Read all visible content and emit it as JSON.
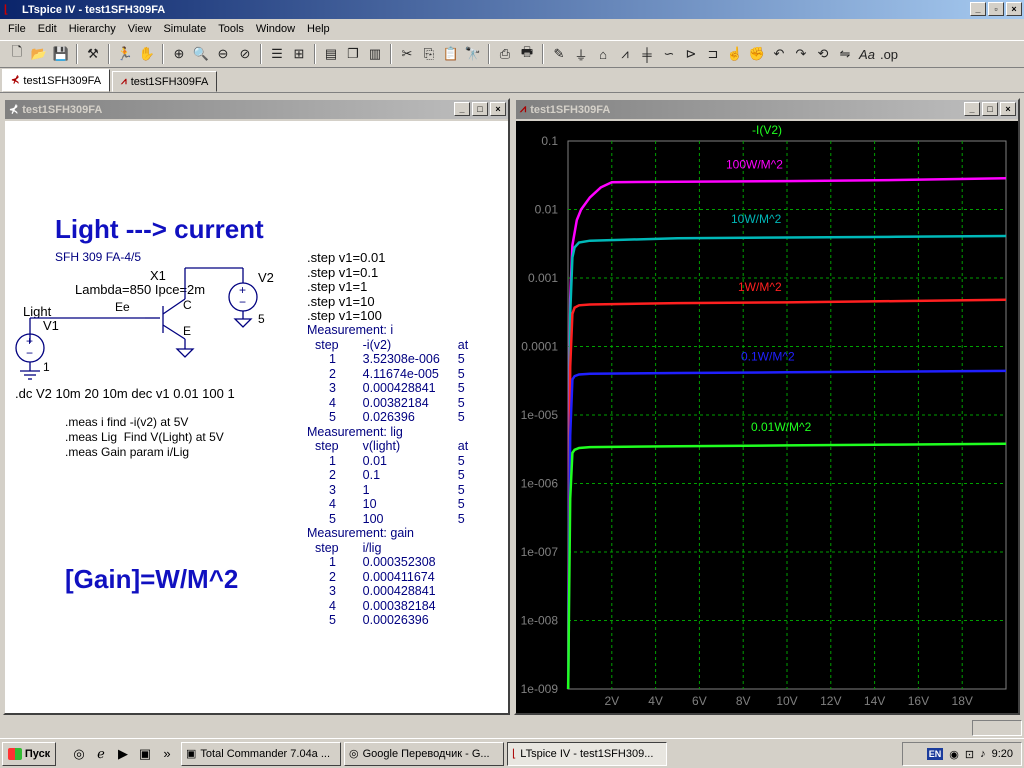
{
  "window": {
    "title": "LTspice IV - test1SFH309FA",
    "minimize": "_",
    "restore": "▫",
    "close": "×"
  },
  "menu": [
    {
      "label": "File",
      "mn": "F"
    },
    {
      "label": "Edit",
      "mn": "E"
    },
    {
      "label": "Hierarchy",
      "mn": "H"
    },
    {
      "label": "View",
      "mn": "V"
    },
    {
      "label": "Simulate",
      "mn": "S"
    },
    {
      "label": "Tools",
      "mn": "T"
    },
    {
      "label": "Window",
      "mn": "W"
    },
    {
      "label": "Help",
      "mn": "H"
    }
  ],
  "tabs": [
    {
      "label": "test1SFH309FA",
      "icon": "transistor-icon"
    },
    {
      "label": "test1SFH309FA",
      "icon": "waveform-icon"
    }
  ],
  "schematic": {
    "title": "test1SFH309FA",
    "heading": "Light ---> current",
    "part": "SFH 309 FA-4/5",
    "x1": "X1",
    "lambda": "Lambda=850 Ipce=2m",
    "c": "C",
    "e": "E",
    "ee": "Ee",
    "v2": "V2",
    "v2_val": "5",
    "light": "Light",
    "v1": "V1",
    "v1_val": "1",
    "dc": ".dc V2 10m 20 10m dec v1 0.01 100 1",
    "meas1": ".meas i find -i(v2) at 5V",
    "meas2": ".meas Lig  Find V(Light) at 5V",
    "meas3": ".meas Gain param i/Lig",
    "gain": "[Gain]=W/M^2",
    "steps": [
      ".step v1=0.01",
      ".step v1=0.1",
      ".step v1=1",
      ".step v1=10",
      ".step v1=100"
    ],
    "measurements": [
      {
        "title": "Measurement: i",
        "cols": [
          "step",
          "-i(v2)",
          "at"
        ],
        "rows": [
          [
            "1",
            "3.52308e-006",
            "5"
          ],
          [
            "2",
            "4.11674e-005",
            "5"
          ],
          [
            "3",
            "0.000428841",
            "5"
          ],
          [
            "4",
            "0.00382184",
            "5"
          ],
          [
            "5",
            "0.026396",
            "5"
          ]
        ]
      },
      {
        "title": "Measurement: lig",
        "cols": [
          "step",
          "v(light)",
          "at"
        ],
        "rows": [
          [
            "1",
            "0.01",
            "5"
          ],
          [
            "2",
            "0.1",
            "5"
          ],
          [
            "3",
            "1",
            "5"
          ],
          [
            "4",
            "10",
            "5"
          ],
          [
            "5",
            "100",
            "5"
          ]
        ]
      },
      {
        "title": "Measurement: gain",
        "cols": [
          "step",
          "i/lig",
          ""
        ],
        "rows": [
          [
            "1",
            "0.000352308",
            ""
          ],
          [
            "2",
            "0.000411674",
            ""
          ],
          [
            "3",
            "0.000428841",
            ""
          ],
          [
            "4",
            "0.000382184",
            ""
          ],
          [
            "5",
            "0.00026396",
            ""
          ]
        ]
      }
    ]
  },
  "waveform": {
    "title": "test1SFH309FA"
  },
  "chart_data": {
    "type": "line",
    "title": "-I(V2)",
    "xlabel": "",
    "ylabel": "",
    "xlim": [
      0,
      20
    ],
    "ylim": [
      1e-09,
      0.1
    ],
    "yscale": "log",
    "grid": true,
    "x_ticks": [
      "2V",
      "4V",
      "6V",
      "8V",
      "10V",
      "12V",
      "14V",
      "16V",
      "18V"
    ],
    "y_ticks": [
      "0.1",
      "0.01",
      "0.001",
      "0.0001",
      "1e-005",
      "1e-006",
      "1e-007",
      "1e-008",
      "1e-009"
    ],
    "series": [
      {
        "name": "100W/M^2",
        "color": "#ff00ff",
        "x": [
          0.01,
          0.05,
          0.1,
          0.2,
          0.4,
          0.6,
          1.0,
          1.5,
          2.0,
          5,
          10,
          15,
          20
        ],
        "y": [
          1e-09,
          1e-05,
          0.0005,
          0.003,
          0.007,
          0.01,
          0.015,
          0.021,
          0.025,
          0.0255,
          0.026,
          0.027,
          0.0285
        ]
      },
      {
        "name": "10W/M^2",
        "color": "#00b8b8",
        "x": [
          0.01,
          0.05,
          0.1,
          0.2,
          0.3,
          0.5,
          1,
          5,
          10,
          15,
          20
        ],
        "y": [
          1e-09,
          1e-06,
          0.0003,
          0.002,
          0.0028,
          0.0033,
          0.0035,
          0.0038,
          0.0039,
          0.004,
          0.0041
        ]
      },
      {
        "name": "1W/M^2",
        "color": "#ff2020",
        "x": [
          0.01,
          0.05,
          0.1,
          0.2,
          0.3,
          0.5,
          1,
          5,
          10,
          15,
          20
        ],
        "y": [
          1e-09,
          2e-07,
          5e-05,
          0.0003,
          0.00037,
          0.0004,
          0.00041,
          0.00043,
          0.00044,
          0.00046,
          0.00048
        ]
      },
      {
        "name": "0.1W/M^2",
        "color": "#2020ff",
        "x": [
          0.01,
          0.05,
          0.1,
          0.2,
          0.3,
          0.5,
          1,
          5,
          10,
          15,
          20
        ],
        "y": [
          1e-09,
          8e-08,
          5e-06,
          3.3e-05,
          3.7e-05,
          3.9e-05,
          4e-05,
          4.1e-05,
          4.2e-05,
          4.3e-05,
          4.4e-05
        ]
      },
      {
        "name": "0.01W/M^2",
        "color": "#20ff20",
        "x": [
          0.01,
          0.05,
          0.1,
          0.2,
          0.3,
          0.5,
          1,
          5,
          10,
          15,
          20
        ],
        "y": [
          1e-09,
          2e-08,
          6e-07,
          2.8e-06,
          3.1e-06,
          3.3e-06,
          3.4e-06,
          3.5e-06,
          3.6e-06,
          3.7e-06,
          3.8e-06
        ]
      }
    ]
  },
  "taskbar": {
    "start": "Пуск",
    "tasks": [
      {
        "label": "Total Commander 7.04a ...",
        "icon": "floppy-icon"
      },
      {
        "label": "Google Переводчик - G...",
        "icon": "chrome-icon"
      },
      {
        "label": "LTspice IV - test1SFH309...",
        "icon": "ltspice-icon"
      }
    ],
    "lang": "EN",
    "clock": "9:20"
  }
}
